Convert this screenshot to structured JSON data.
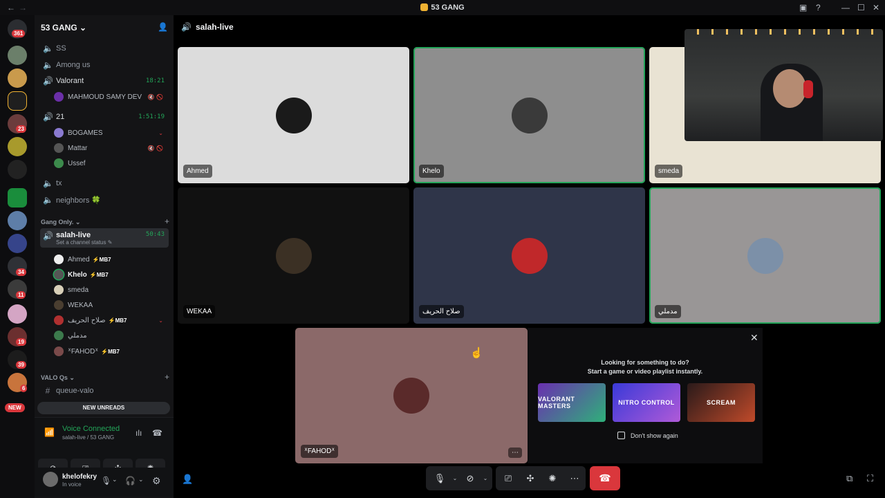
{
  "window": {
    "title": "53 GANG"
  },
  "rail": {
    "badges": [
      "361",
      "23",
      "34",
      "11",
      "19",
      "39",
      "6"
    ],
    "new_label": "NEW"
  },
  "guild": {
    "name": "53 GANG",
    "chevron": "⌄"
  },
  "channels": [
    {
      "name": "SS",
      "kind": "voice"
    },
    {
      "name": "Among us",
      "kind": "voice"
    },
    {
      "name": "Valorant",
      "kind": "voice-active",
      "time": "18:21"
    },
    {
      "name": "21",
      "kind": "voice-active",
      "time": "1:51:19"
    },
    {
      "name": "tx",
      "kind": "voice"
    },
    {
      "name": "neighbors 🍀",
      "kind": "voice"
    }
  ],
  "valorant_users": [
    {
      "name": "MAHMOUD SAMY DEV",
      "status": "🔇 🚫"
    }
  ],
  "room21_users": [
    {
      "name": "BOGAMES",
      "status": "⌄"
    },
    {
      "name": "Mattar",
      "status": "🔇 🚫"
    },
    {
      "name": "Ussef",
      "status": ""
    }
  ],
  "category_gang": {
    "label": "Gang Only.",
    "chevron": "⌄",
    "plus": "+"
  },
  "active_channel": {
    "name": "salah-live",
    "time": "50:43",
    "sub": "Set a channel status ✎"
  },
  "salah_users": [
    {
      "name": "Ahmed",
      "flag": "MB7"
    },
    {
      "name": "Khelo",
      "flag": "MB7"
    },
    {
      "name": "smeda",
      "flag": ""
    },
    {
      "name": "WEKAA",
      "flag": ""
    },
    {
      "name": "صلاح الحريف",
      "flag": "MB7"
    },
    {
      "name": "مدملي",
      "flag": ""
    },
    {
      "name": "ᕁFAHODᕁ",
      "flag": "MB7"
    }
  ],
  "category_valo": {
    "label": "VALO Qs",
    "chevron": "⌄",
    "plus": "+"
  },
  "queue_channel": {
    "name": "queue-valo"
  },
  "new_unreads": "NEW UNREADS",
  "voice_panel": {
    "status": "Voice Connected",
    "sub": "salah-live / 53 GANG"
  },
  "user_panel": {
    "name": "khelofekry",
    "status": "In voice"
  },
  "main": {
    "channel": "salah-live",
    "tiles": [
      {
        "name": "Ahmed",
        "bg": "#dcdcdc",
        "pic": "#1a1a1a",
        "speaking": false
      },
      {
        "name": "Khelo",
        "bg": "#8e8e8e",
        "pic": "#3a3a3a",
        "speaking": true
      },
      {
        "name": "smeda",
        "bg": "#e9e3d3",
        "pic": "#c8c0ae",
        "speaking": false
      },
      {
        "name": "WEKAA",
        "bg": "#111111",
        "pic": "#3b3024",
        "speaking": false
      },
      {
        "name": "صلاح الحريف",
        "bg": "#2f3549",
        "pic": "#c0282a",
        "speaking": false
      },
      {
        "name": "مدملي",
        "bg": "#999696",
        "pic": "#7c90a8",
        "speaking": true
      },
      {
        "name": "ᕁFAHODᕁ",
        "bg": "#8b6969",
        "pic": "#5a2a2a",
        "speaking": false
      }
    ]
  },
  "activity": {
    "line1": "Looking for something to do?",
    "line2": "Start a game or video playlist instantly.",
    "cards": [
      "VALORANT MASTERS",
      "NITRO CONTROL",
      "SCREAM"
    ],
    "dont_show": "Don't show again"
  }
}
